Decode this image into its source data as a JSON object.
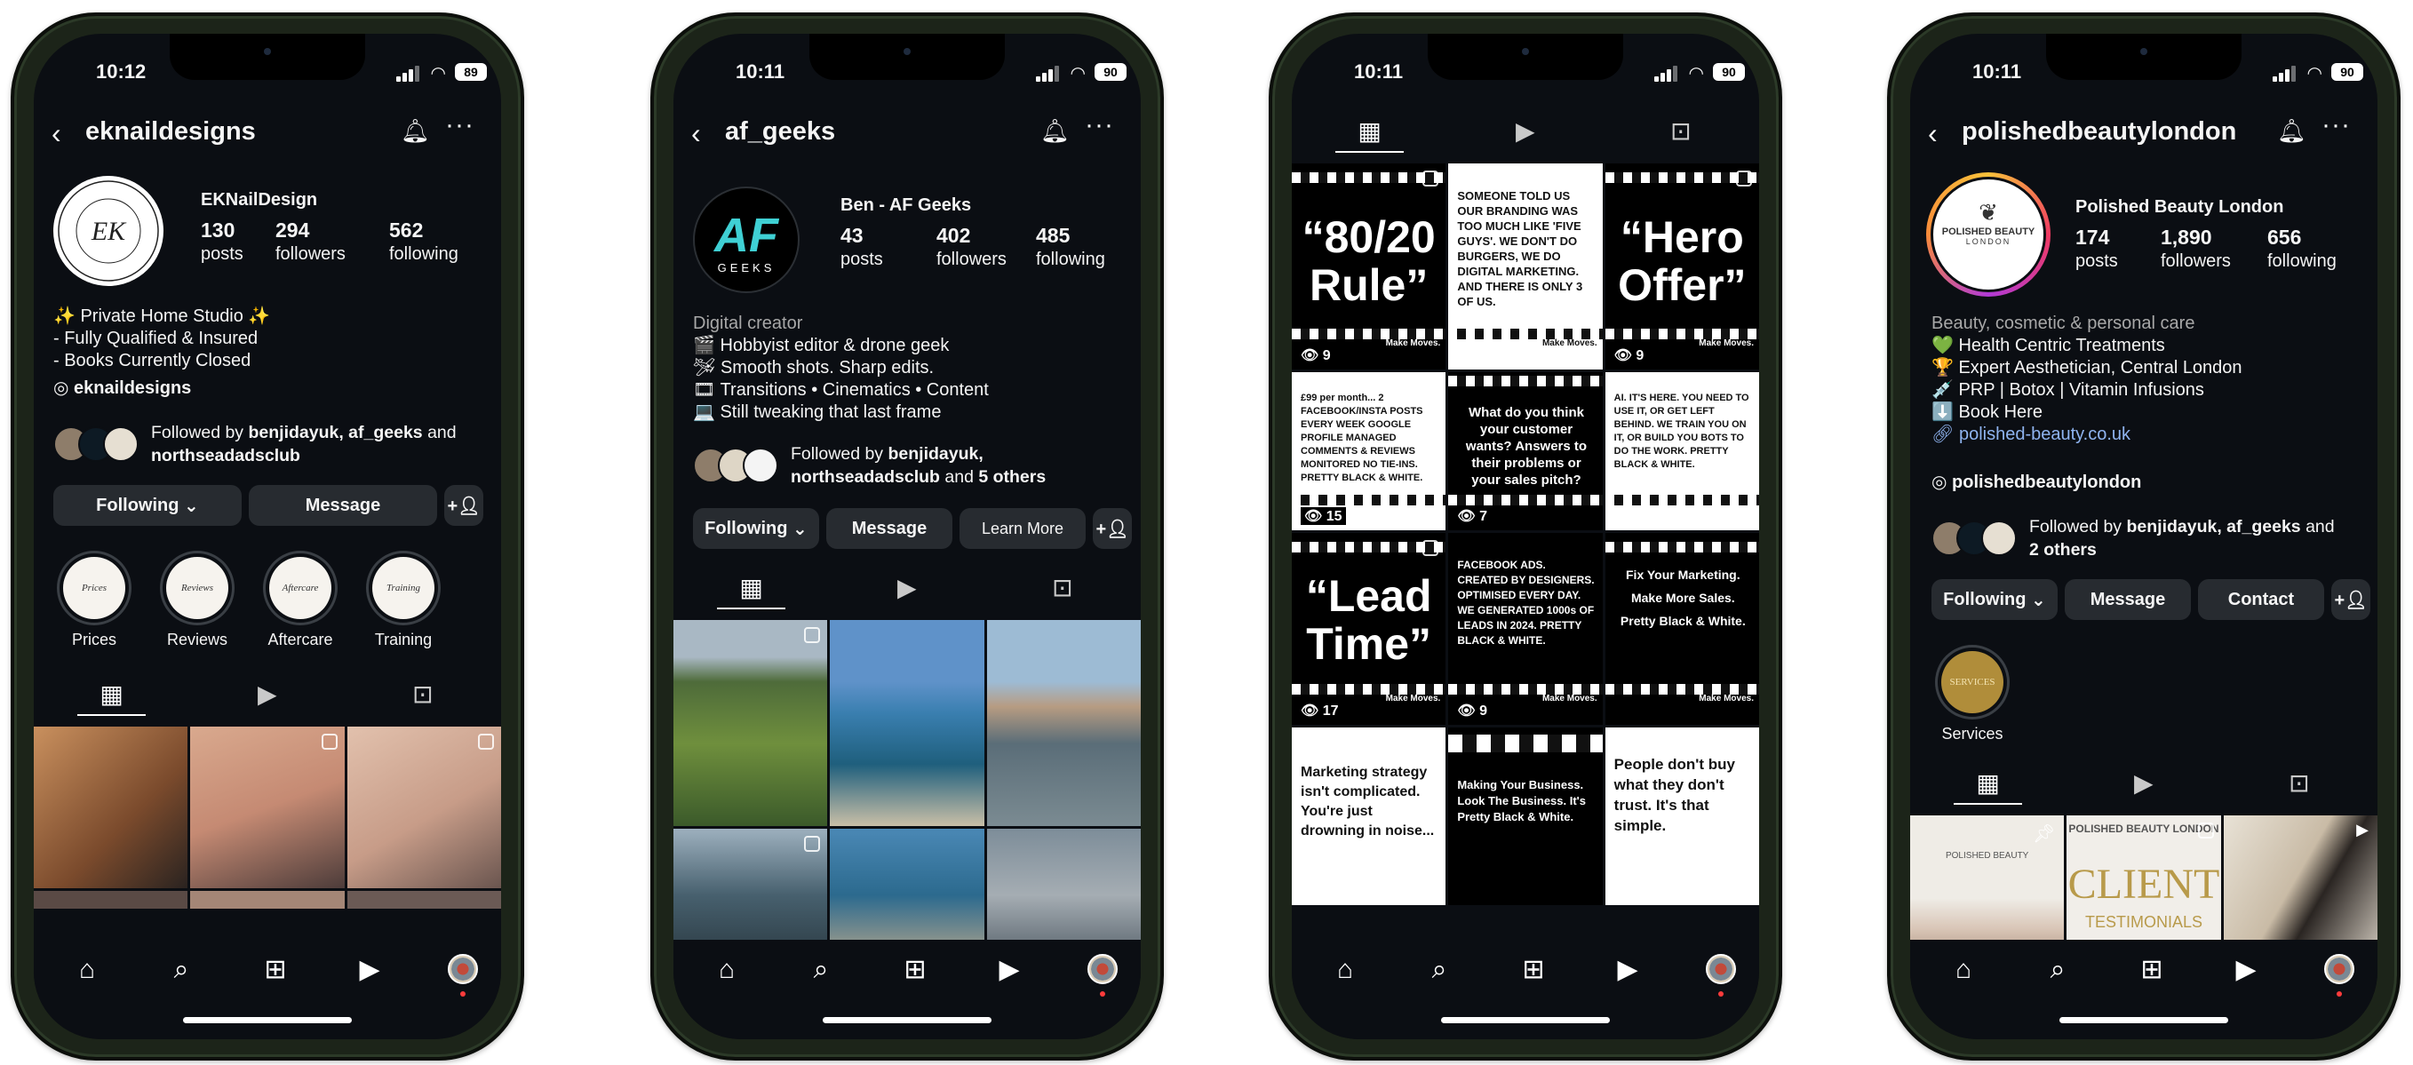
{
  "phones": [
    {
      "time": "10:12",
      "battery": "89",
      "username": "eknaildesigns",
      "display_name": "EKNailDesign",
      "posts": "130",
      "followers": "294",
      "following": "562",
      "posts_label": "posts",
      "followers_label": "followers",
      "following_label": "following",
      "bio": [
        "✨ Private Home Studio ✨",
        "- Fully Qualified & Insured",
        "- Books Currently Closed"
      ],
      "threads_handle": "eknaildesigns",
      "followed_by": {
        "prefix": "Followed by",
        "names": "benjidayuk, af_geeks",
        "mid": "and",
        "rest": "northseadadsclub"
      },
      "buttons": [
        "Following",
        "Message"
      ],
      "highlights": [
        {
          "label": "Prices",
          "cover": "Prices"
        },
        {
          "label": "Reviews",
          "cover": "Reviews"
        },
        {
          "label": "Aftercare",
          "cover": "Aftercare"
        },
        {
          "label": "Training",
          "cover": "Training"
        }
      ]
    },
    {
      "time": "10:11",
      "battery": "90",
      "username": "af_geeks",
      "display_name": "Ben - AF Geeks",
      "posts": "43",
      "followers": "402",
      "following": "485",
      "category": "Digital creator",
      "bio": [
        "🎬 Hobbyist editor & drone geek",
        "🛩 Smooth shots. Sharp edits.",
        "🎞 Transitions • Cinematics • Content",
        "💻 Still tweaking that last frame"
      ],
      "followed_by": {
        "prefix": "Followed by",
        "names": "benjidayuk,",
        "rest": "northseadadsclub",
        "mid": "and",
        "others": "5 others"
      },
      "buttons": [
        "Following",
        "Message",
        "Learn More"
      ],
      "avatar_text": "AF",
      "avatar_sub": "GEEKS"
    },
    {
      "time": "10:11",
      "battery": "90",
      "posts_grid": [
        {
          "kind": "big",
          "text1": "“80/20",
          "text2": "Rule”",
          "views": "9"
        },
        {
          "kind": "white",
          "text": "SOMEONE TOLD US OUR BRANDING WAS TOO MUCH LIKE 'FIVE GUYS'. WE DON'T DO BURGERS, WE DO DIGITAL MARKETING. AND THERE IS ONLY 3 OF US."
        },
        {
          "kind": "big",
          "text1": "“Hero",
          "text2": "Offer”",
          "views": "9"
        },
        {
          "kind": "white",
          "text": "£99 per month... 2 FACEBOOK/INSTA POSTS EVERY WEEK GOOGLE PROFILE MANAGED COMMENTS & REVIEWS MONITORED NO TIE-INS. PRETTY BLACK & WHITE.",
          "views": "15"
        },
        {
          "kind": "dark",
          "text": "What do you think your customer wants? Answers to their problems or your sales pitch?",
          "views": "7"
        },
        {
          "kind": "white",
          "text": "AI. IT'S HERE. YOU NEED TO USE IT, OR GET LEFT BEHIND. WE TRAIN YOU ON IT, OR BUILD YOU BOTS TO DO THE WORK. PRETTY BLACK & WHITE."
        },
        {
          "kind": "big",
          "text1": "“Lead",
          "text2": "Time”",
          "views": "17"
        },
        {
          "kind": "dark",
          "text": "FACEBOOK ADS. CREATED BY DESIGNERS. OPTIMISED EVERY DAY. WE GENERATED 1000s OF LEADS IN 2024. PRETTY BLACK & WHITE.",
          "views": "9"
        },
        {
          "kind": "dark",
          "text": "Fix Your Marketing. Make More Sales. Pretty Black & White."
        },
        {
          "kind": "white",
          "text": "Marketing strategy isn't complicated. You're just drowning in noise..."
        },
        {
          "kind": "dark",
          "text": "Making Your Business. Look The Business. It's Pretty Black & White."
        },
        {
          "kind": "white",
          "text": "People don't buy what they don't trust. It's that simple."
        }
      ],
      "make_moves": "Make Moves."
    },
    {
      "time": "10:11",
      "battery": "90",
      "username": "polishedbeautylondon",
      "display_name": "Polished Beauty London",
      "posts": "174",
      "followers": "1,890",
      "following": "656",
      "category": "Beauty, cosmetic & personal care",
      "bio": [
        "💚 Health Centric Treatments",
        "🏆 Expert Aesthetician, Central London",
        "💉 PRP | Botox | Vitamin Infusions",
        "⬇️ Book Here"
      ],
      "link": "polished-beauty.co.uk",
      "threads_handle": "polishedbeautylondon",
      "followed_by": {
        "prefix": "Followed by",
        "names": "benjidayuk, af_geeks",
        "mid": "and",
        "rest": "2 others"
      },
      "buttons": [
        "Following",
        "Message",
        "Contact"
      ],
      "highlights": [
        {
          "label": "Services",
          "cover": "SERVICES"
        }
      ],
      "avatar_text": "POLISHED BEAUTY",
      "avatar_sub": "LONDON",
      "grid_texts": [
        "POLISHED BEAUTY",
        "POLISHED BEAUTY LONDON",
        "CLIENT",
        "TESTIMONIALS"
      ]
    }
  ],
  "colors": {
    "bg": "#0b0e13",
    "button": "#272b30",
    "link": "#8fb4f0",
    "frame": "#1c2419"
  },
  "icons": {
    "back": "chevron-left",
    "bell": "bell",
    "more": "ellipsis",
    "grid": "grid",
    "reels": "reels",
    "tagged": "tagged",
    "home": "home",
    "search": "search",
    "create": "plus-square",
    "add_user": "person-plus"
  }
}
